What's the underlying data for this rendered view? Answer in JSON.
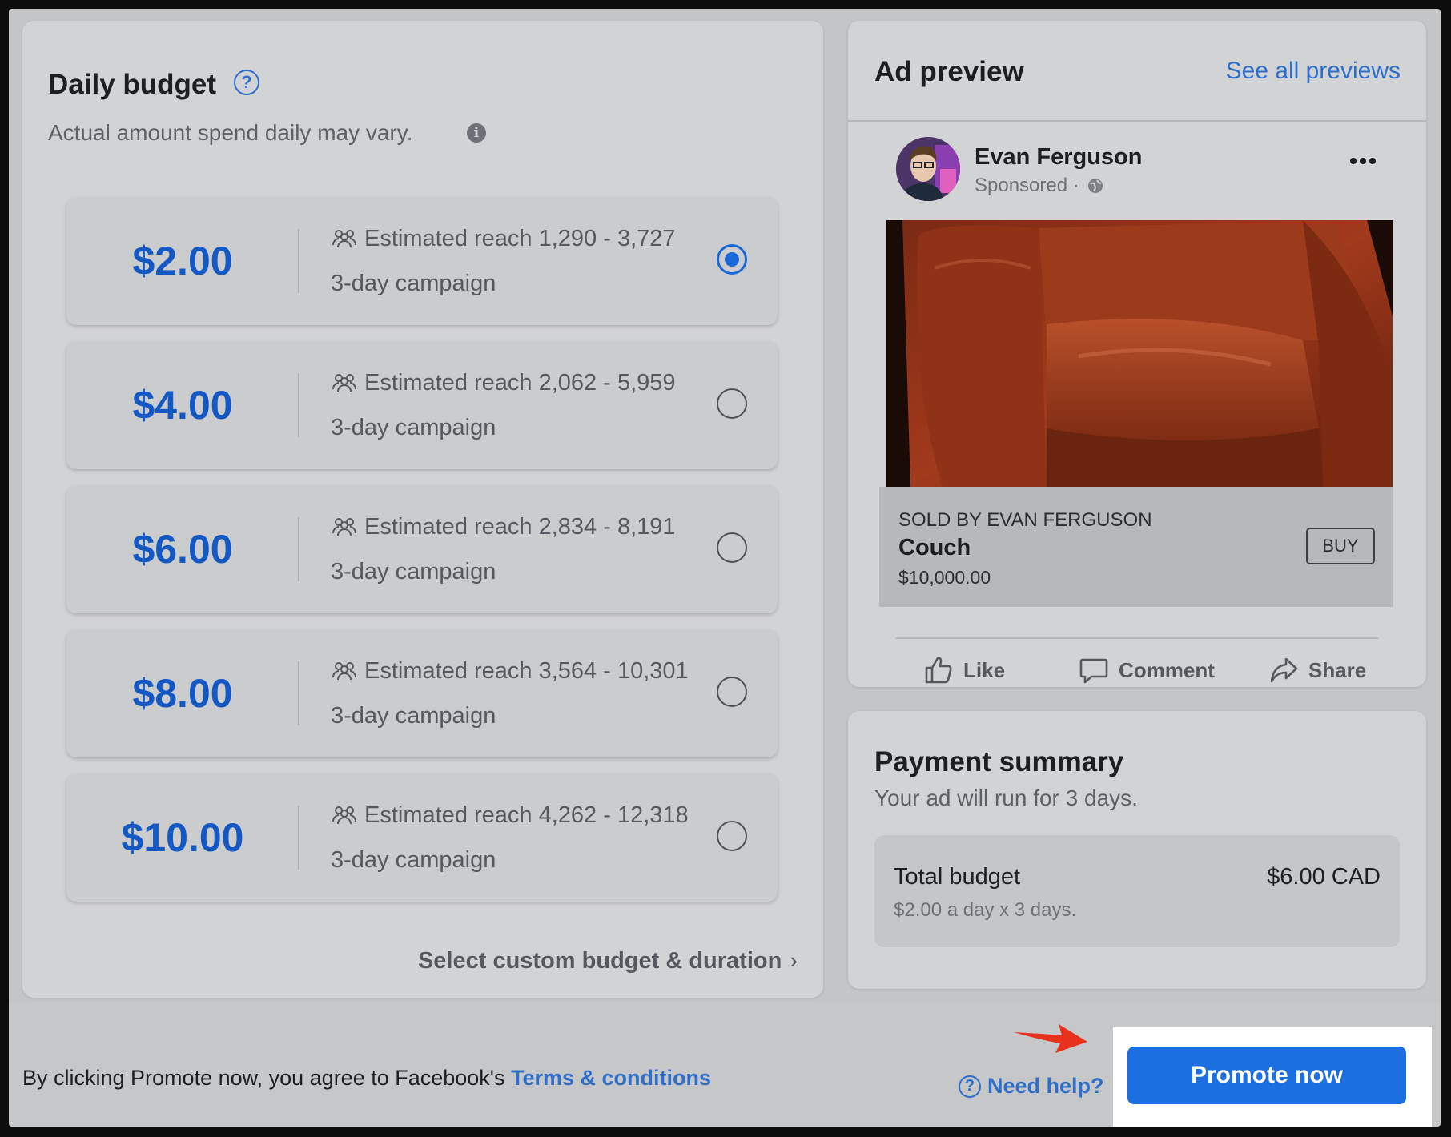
{
  "budget": {
    "title": "Daily budget",
    "subtitle": "Actual amount spend daily may vary.",
    "selected_index": 0,
    "options": [
      {
        "price": "$2.00",
        "reach": "Estimated reach 1,290 - 3,727",
        "duration": "3-day campaign"
      },
      {
        "price": "$4.00",
        "reach": "Estimated reach 2,062 - 5,959",
        "duration": "3-day campaign"
      },
      {
        "price": "$6.00",
        "reach": "Estimated reach 2,834 - 8,191",
        "duration": "3-day campaign"
      },
      {
        "price": "$8.00",
        "reach": "Estimated reach 3,564 - 10,301",
        "duration": "3-day campaign"
      },
      {
        "price": "$10.00",
        "reach": "Estimated reach 4,262 - 12,318",
        "duration": "3-day campaign"
      }
    ],
    "custom_link": "Select custom budget & duration"
  },
  "preview": {
    "title": "Ad preview",
    "see_all": "See all previews",
    "poster_name": "Evan Ferguson",
    "sponsored": "Sponsored ·",
    "sold_by": "SOLD BY EVAN FERGUSON",
    "product": "Couch",
    "price": "$10,000.00",
    "buy": "BUY",
    "actions": {
      "like": "Like",
      "comment": "Comment",
      "share": "Share"
    }
  },
  "payment": {
    "title": "Payment summary",
    "subtitle": "Your ad will run for 3 days.",
    "total_label": "Total budget",
    "total_value": "$6.00 CAD",
    "total_detail": "$2.00 a day x 3 days."
  },
  "footer": {
    "terms_prefix": "By clicking Promote now, you agree to Facebook's ",
    "terms_link": "Terms & conditions",
    "need_help": "Need help?",
    "promote": "Promote now"
  },
  "colors": {
    "accent": "#1b6fe0",
    "price_blue": "#1458c4",
    "arrow_red": "#e8321e"
  }
}
